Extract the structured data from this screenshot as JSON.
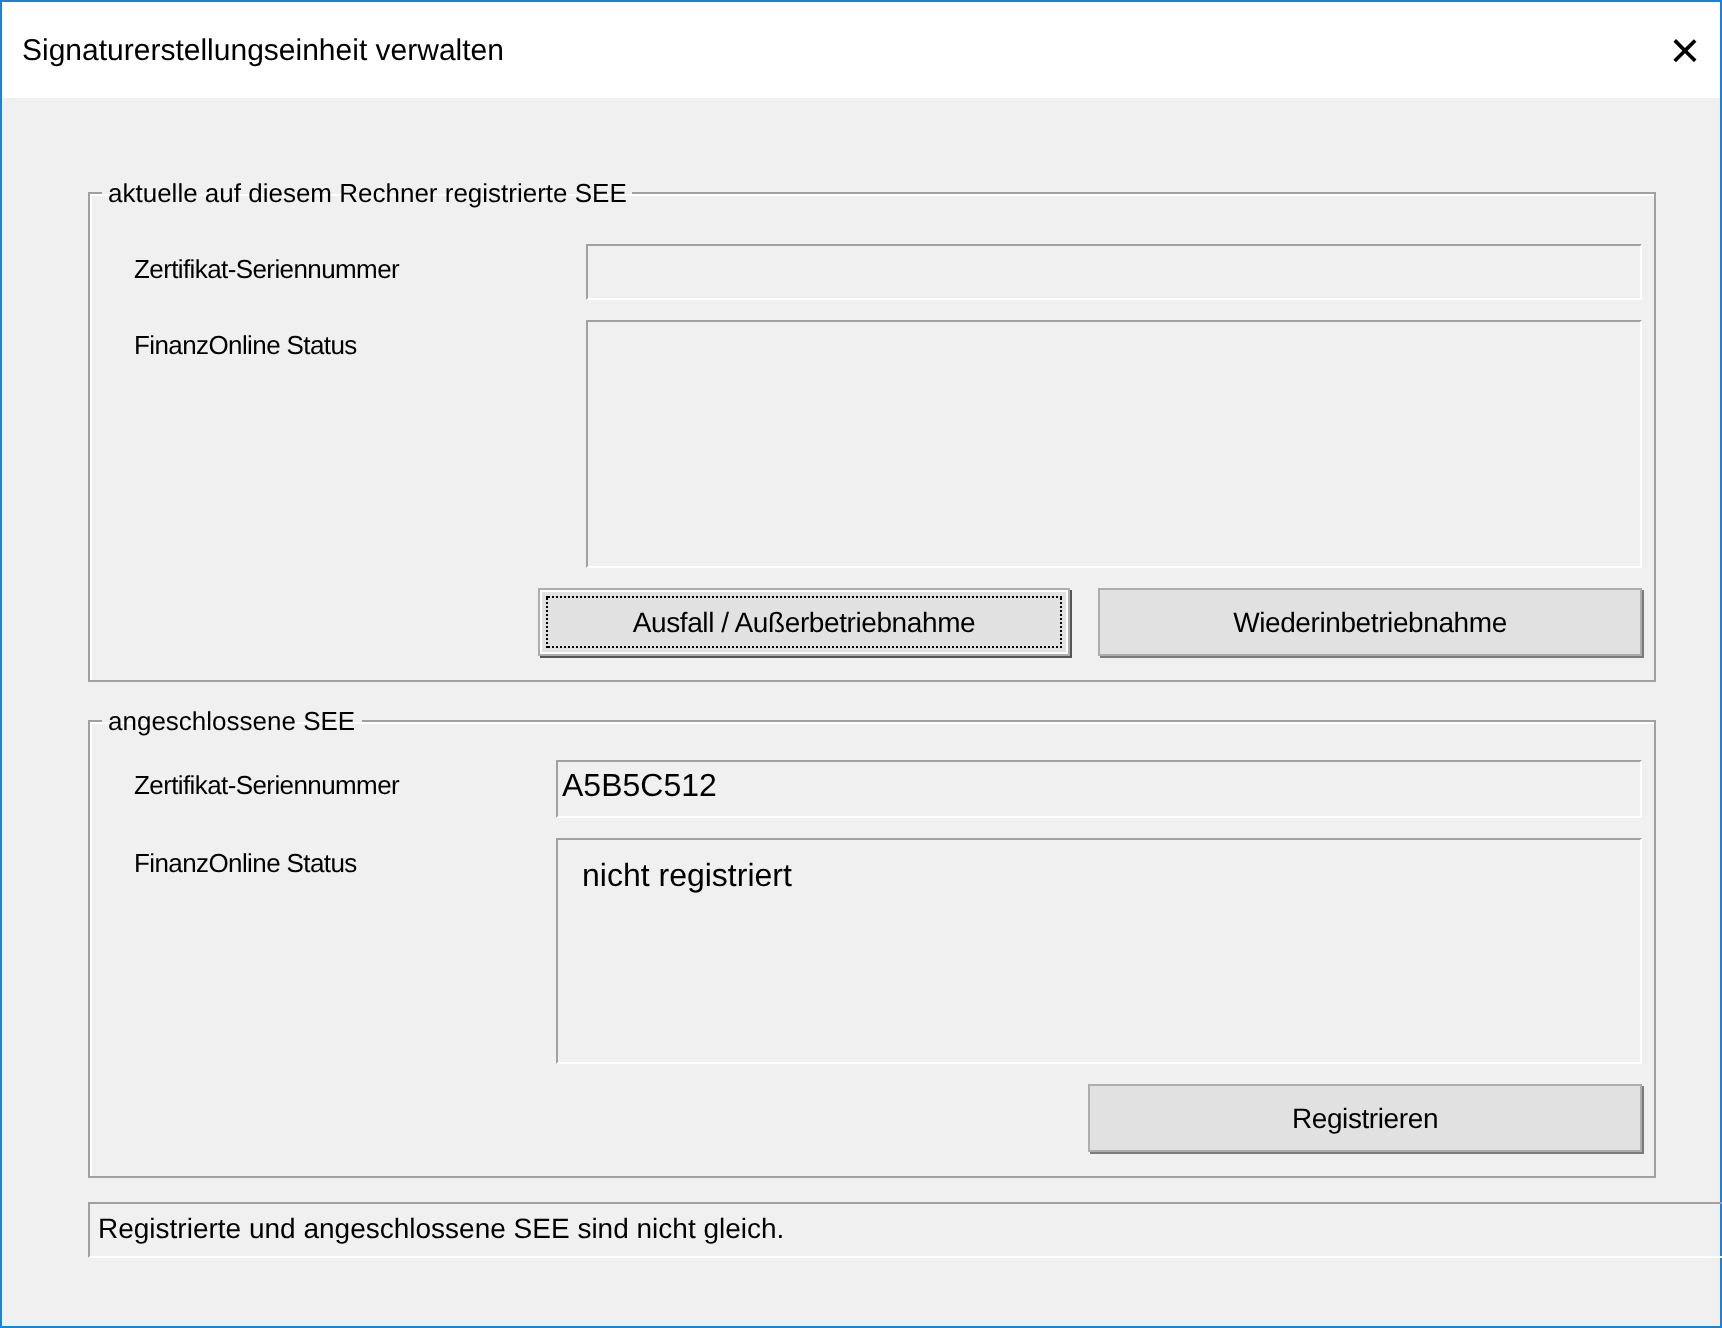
{
  "window": {
    "title": "Signaturerstellungseinheit verwalten",
    "close": "×"
  },
  "groups": [
    {
      "title": "aktuelle auf diesem Rechner registrierte SEE",
      "serial": {
        "label": "Zertifikat-Seriennummer"
      },
      "status": {
        "label": "FinanzOnline Status"
      },
      "buttons": [
        {
          "label": "Ausfall / Außerbetriebnahme",
          "focused": true
        },
        {
          "label": "Wiederinbetriebnahme",
          "focused": false
        }
      ]
    },
    {
      "title": "angeschlossene SEE",
      "serial": {
        "label": "Zertifikat-Seriennummer",
        "value": "A5B5C512"
      },
      "status": {
        "label": "FinanzOnline Status",
        "value": "nicht registriert"
      },
      "buttons": [
        {
          "label": "Registrieren",
          "focused": false
        }
      ]
    }
  ],
  "status_bar": "Registrierte und angeschlossene SEE sind nicht gleich."
}
